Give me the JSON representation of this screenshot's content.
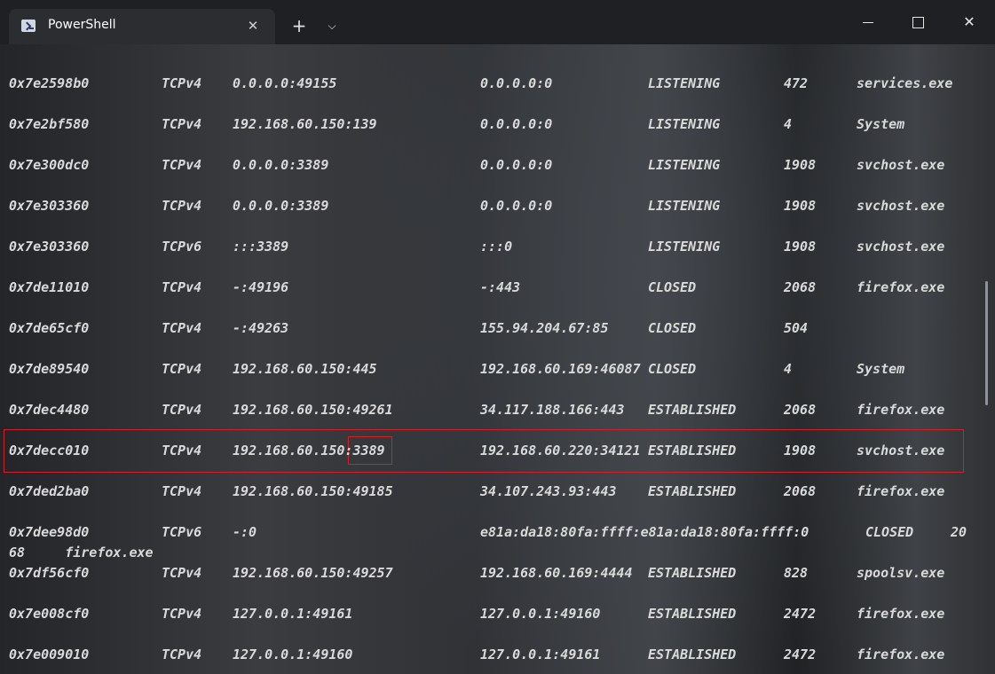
{
  "window": {
    "tab_title": "PowerShell",
    "tab_icon": "powershell-icon",
    "close_tab_glyph": "✕",
    "new_tab_glyph": "+",
    "dropdown_glyph": "⌵",
    "close_glyph": "✕"
  },
  "rows": [
    {
      "offset": "0x7e2598b0",
      "proto": "TCPv4",
      "local": "0.0.0.0:49155",
      "foreign": "0.0.0.0:0",
      "state": "LISTENING",
      "pid": "472",
      "owner": "services.exe"
    },
    {
      "offset": "0x7e2bf580",
      "proto": "TCPv4",
      "local": "192.168.60.150:139",
      "foreign": "0.0.0.0:0",
      "state": "LISTENING",
      "pid": "4",
      "owner": "System"
    },
    {
      "offset": "0x7e300dc0",
      "proto": "TCPv4",
      "local": "0.0.0.0:3389",
      "foreign": "0.0.0.0:0",
      "state": "LISTENING",
      "pid": "1908",
      "owner": "svchost.exe"
    },
    {
      "offset": "0x7e303360",
      "proto": "TCPv4",
      "local": "0.0.0.0:3389",
      "foreign": "0.0.0.0:0",
      "state": "LISTENING",
      "pid": "1908",
      "owner": "svchost.exe"
    },
    {
      "offset": "0x7e303360",
      "proto": "TCPv6",
      "local": ":::3389",
      "foreign": ":::0",
      "state": "LISTENING",
      "pid": "1908",
      "owner": "svchost.exe"
    },
    {
      "offset": "0x7de11010",
      "proto": "TCPv4",
      "local": "-:49196",
      "foreign": "-:443",
      "state": "CLOSED",
      "pid": "2068",
      "owner": "firefox.exe"
    },
    {
      "offset": "0x7de65cf0",
      "proto": "TCPv4",
      "local": "-:49263",
      "foreign": "155.94.204.67:85",
      "state": "CLOSED",
      "pid": "504",
      "owner": ""
    },
    {
      "offset": "0x7de89540",
      "proto": "TCPv4",
      "local": "192.168.60.150:445",
      "foreign": "192.168.60.169:46087",
      "state": "CLOSED",
      "pid": "4",
      "owner": "System"
    },
    {
      "offset": "0x7dec4480",
      "proto": "TCPv4",
      "local": "192.168.60.150:49261",
      "foreign": "34.117.188.166:443",
      "state": "ESTABLISHED",
      "pid": "2068",
      "owner": "firefox.exe"
    },
    {
      "offset": "0x7decc010",
      "proto": "TCPv4",
      "local": "192.168.60.150:3389",
      "foreign": "192.168.60.220:34121",
      "state": "ESTABLISHED",
      "pid": "1908",
      "owner": "svchost.exe"
    },
    {
      "offset": "0x7ded2ba0",
      "proto": "TCPv4",
      "local": "192.168.60.150:49185",
      "foreign": "34.107.243.93:443",
      "state": "ESTABLISHED",
      "pid": "2068",
      "owner": "firefox.exe"
    },
    {
      "offset": "0x7dee98d0",
      "proto": "TCPv6",
      "local": "-:0",
      "foreign": "e81a:da18:80fa:ffff:e81a:da18:80fa:ffff:0",
      "state": "CLOSED",
      "pid": "20",
      "owner": "",
      "wrap": "68     firefox.exe"
    },
    {
      "offset": "0x7df56cf0",
      "proto": "TCPv4",
      "local": "192.168.60.150:49257",
      "foreign": "192.168.60.169:4444",
      "state": "ESTABLISHED",
      "pid": "828",
      "owner": "spoolsv.exe"
    },
    {
      "offset": "0x7e008cf0",
      "proto": "TCPv4",
      "local": "127.0.0.1:49161",
      "foreign": "127.0.0.1:49160",
      "state": "ESTABLISHED",
      "pid": "2472",
      "owner": "firefox.exe"
    },
    {
      "offset": "0x7e009010",
      "proto": "TCPv4",
      "local": "127.0.0.1:49160",
      "foreign": "127.0.0.1:49161",
      "state": "ESTABLISHED",
      "pid": "2472",
      "owner": "firefox.exe"
    }
  ],
  "highlight": {
    "row_index": 9,
    "port": "3389",
    "color": "#d0212a"
  }
}
